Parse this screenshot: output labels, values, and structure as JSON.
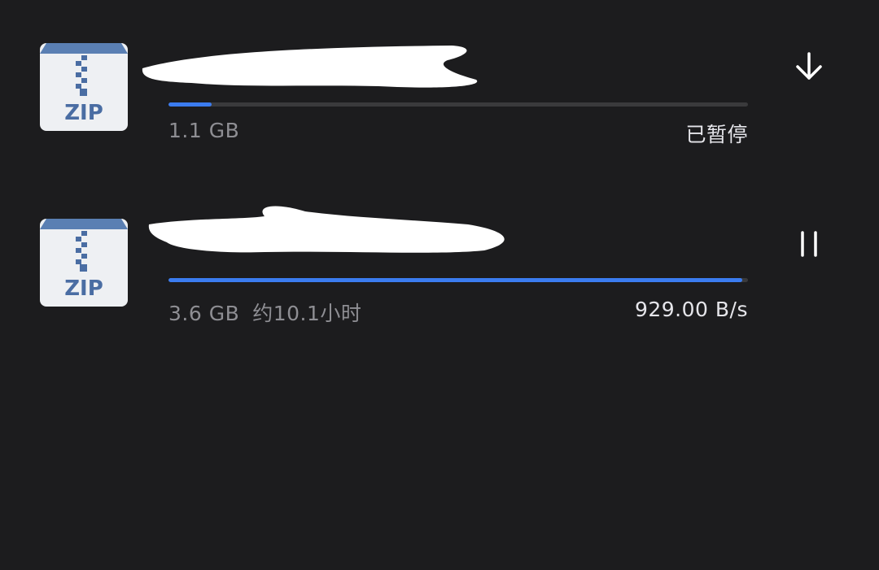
{
  "colors": {
    "background": "#1c1c1e",
    "progress_accent": "#3b7cf0",
    "track": "#3a3a3c",
    "secondary_text": "#8e8e93",
    "primary_text": "#e5e5ea"
  },
  "downloads": [
    {
      "file_type_label": "ZIP",
      "icon": "zip-file-icon",
      "size": "1.1 GB",
      "eta": "",
      "status": "已暂停",
      "progress_fraction": 0.075,
      "action_icon": "arrow-down-icon"
    },
    {
      "file_type_label": "ZIP",
      "icon": "zip-file-icon",
      "size": "3.6 GB",
      "eta": "约10.1小时",
      "status": "929.00 B/s",
      "progress_fraction": 0.99,
      "action_icon": "pause-icon"
    }
  ]
}
